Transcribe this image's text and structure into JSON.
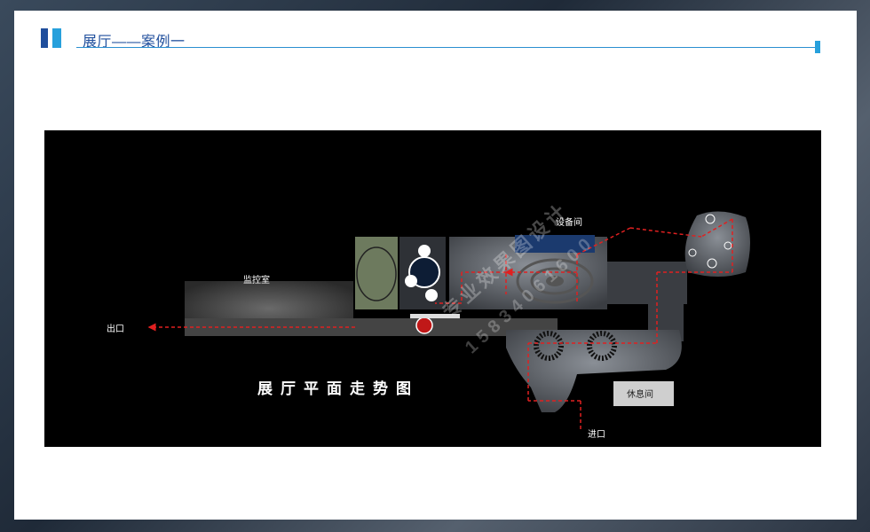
{
  "header": {
    "title": "展厅——案例一"
  },
  "plan": {
    "title": "展厅平面走势图",
    "rooms": {
      "monitor_room": "监控室",
      "equipment_room": "设备间",
      "rest_room": "休息间"
    },
    "exit_label": "出口",
    "entrance_label": "进口",
    "watermark_text": "专业效果图设计",
    "watermark_phone": "15834061600"
  },
  "colors": {
    "accent_dark": "#1f4e9c",
    "accent_light": "#27a0dc",
    "route_arrow": "#e02020",
    "floor": "#3c3c3c"
  }
}
